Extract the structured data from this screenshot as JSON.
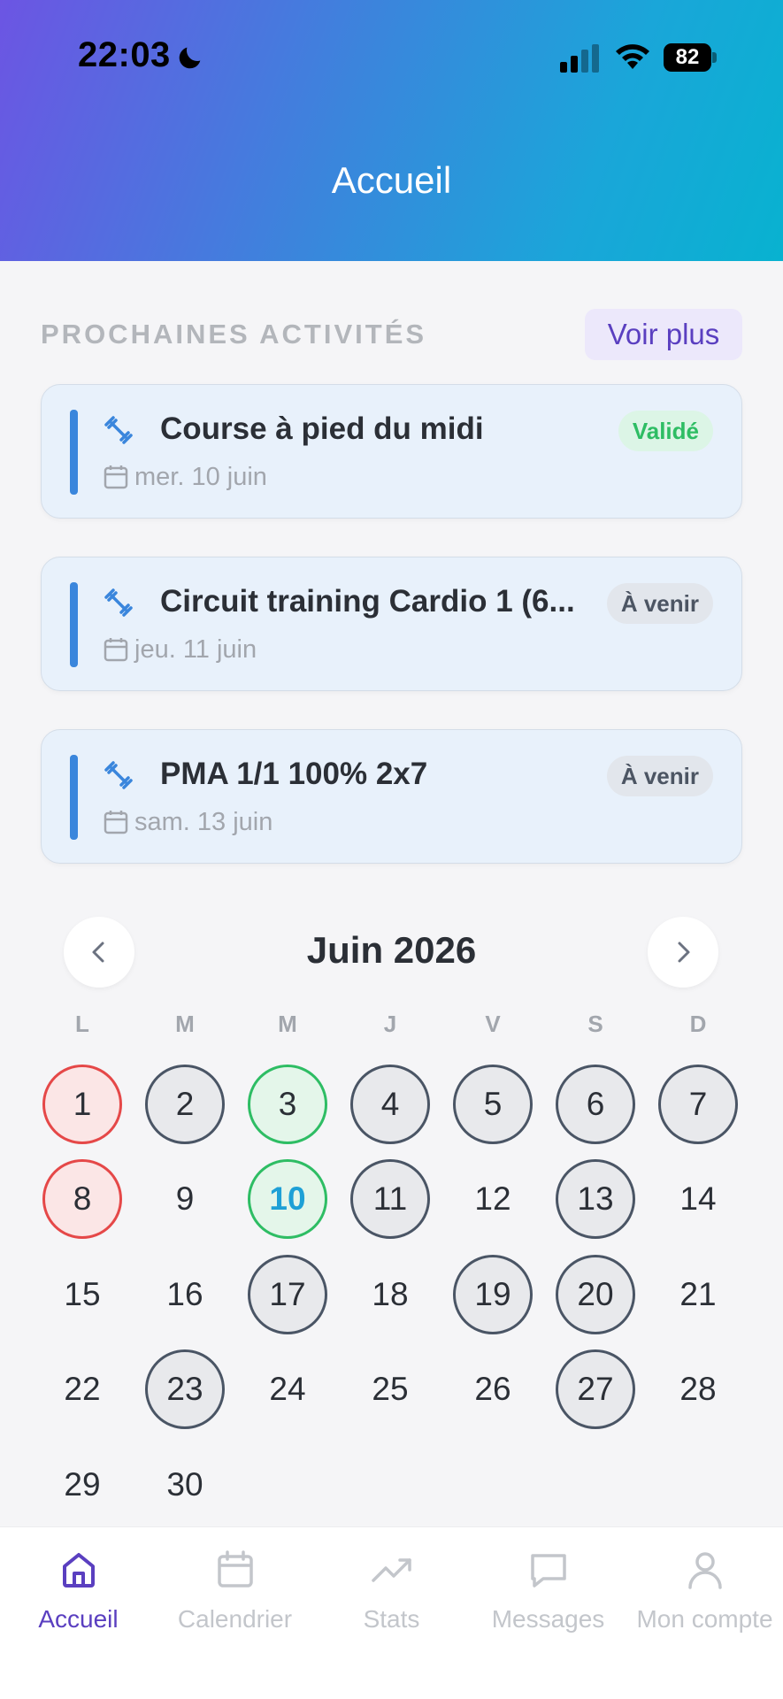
{
  "status_bar": {
    "time": "22:03",
    "battery": "82"
  },
  "header": {
    "title": "Accueil"
  },
  "upcoming": {
    "section_title": "PROCHAINES ACTIVITÉS",
    "see_more": "Voir plus",
    "activities": [
      {
        "title": "Course à pied du midi",
        "date": "mer. 10 juin",
        "status": "Validé",
        "icon": "dumbbell-icon"
      },
      {
        "title": "Circuit training Cardio 1 (6...",
        "date": "jeu. 11 juin",
        "status": "À venir",
        "icon": "dumbbell-icon"
      },
      {
        "title": "PMA 1/1 100% 2x7",
        "date": "sam. 13 juin",
        "status": "À venir",
        "icon": "dumbbell-icon"
      }
    ]
  },
  "calendar": {
    "month_title": "Juin 2026",
    "weekdays": [
      "L",
      "M",
      "M",
      "J",
      "V",
      "S",
      "D"
    ],
    "days": [
      {
        "n": "1",
        "state": "missed"
      },
      {
        "n": "2",
        "state": "planned"
      },
      {
        "n": "3",
        "state": "done"
      },
      {
        "n": "4",
        "state": "planned"
      },
      {
        "n": "5",
        "state": "planned"
      },
      {
        "n": "6",
        "state": "planned"
      },
      {
        "n": "7",
        "state": "planned"
      },
      {
        "n": "8",
        "state": "missed"
      },
      {
        "n": "9",
        "state": ""
      },
      {
        "n": "10",
        "state": "done today"
      },
      {
        "n": "11",
        "state": "planned"
      },
      {
        "n": "12",
        "state": ""
      },
      {
        "n": "13",
        "state": "planned"
      },
      {
        "n": "14",
        "state": ""
      },
      {
        "n": "15",
        "state": ""
      },
      {
        "n": "16",
        "state": ""
      },
      {
        "n": "17",
        "state": "planned"
      },
      {
        "n": "18",
        "state": ""
      },
      {
        "n": "19",
        "state": "planned"
      },
      {
        "n": "20",
        "state": "planned"
      },
      {
        "n": "21",
        "state": ""
      },
      {
        "n": "22",
        "state": ""
      },
      {
        "n": "23",
        "state": "planned"
      },
      {
        "n": "24",
        "state": ""
      },
      {
        "n": "25",
        "state": ""
      },
      {
        "n": "26",
        "state": ""
      },
      {
        "n": "27",
        "state": "planned"
      },
      {
        "n": "28",
        "state": ""
      },
      {
        "n": "29",
        "state": ""
      },
      {
        "n": "30",
        "state": ""
      }
    ]
  },
  "tabbar": {
    "tabs": [
      {
        "label": "Accueil",
        "icon": "home-icon",
        "active": true
      },
      {
        "label": "Calendrier",
        "icon": "calendar-icon",
        "active": false
      },
      {
        "label": "Stats",
        "icon": "trend-icon",
        "active": false
      },
      {
        "label": "Messages",
        "icon": "chat-icon",
        "active": false
      },
      {
        "label": "Mon compte",
        "icon": "user-icon",
        "active": false
      }
    ]
  },
  "colors": {
    "accent": "#5a3fc0",
    "header_gradient_start": "#6c55e3",
    "header_gradient_end": "#08b2d0",
    "done": "#2ebd64",
    "missed": "#e54848",
    "planned": "#4a5565",
    "today": "#1ea0d6"
  }
}
